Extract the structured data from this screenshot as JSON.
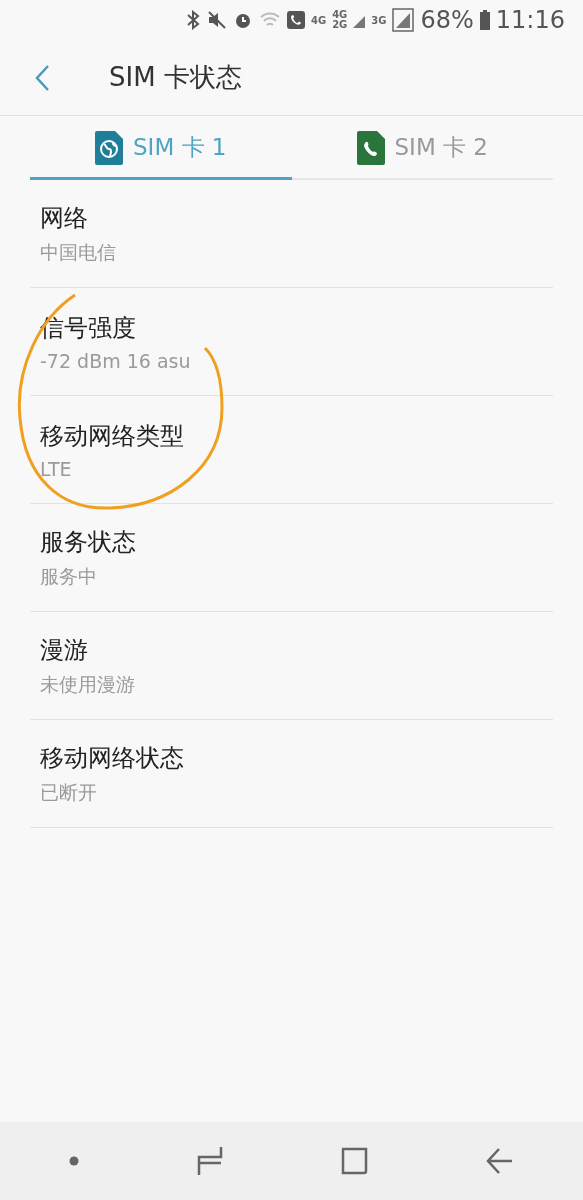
{
  "status_bar": {
    "network_labels": [
      "4G",
      "4G",
      "2G",
      "3G"
    ],
    "battery": "68%",
    "time": "11:16"
  },
  "header": {
    "title": "SIM 卡状态"
  },
  "tabs": [
    {
      "label": "SIM 卡 1",
      "selected": true,
      "kind": "globe"
    },
    {
      "label": "SIM 卡 2",
      "selected": false,
      "kind": "phone"
    }
  ],
  "items": [
    {
      "title": "网络",
      "value": "中国电信"
    },
    {
      "title": "信号强度",
      "value": "-72 dBm 16 asu"
    },
    {
      "title": "移动网络类型",
      "value": "LTE"
    },
    {
      "title": "服务状态",
      "value": "服务中"
    },
    {
      "title": "漫游",
      "value": "未使用漫游"
    },
    {
      "title": "移动网络状态",
      "value": "已断开"
    }
  ]
}
